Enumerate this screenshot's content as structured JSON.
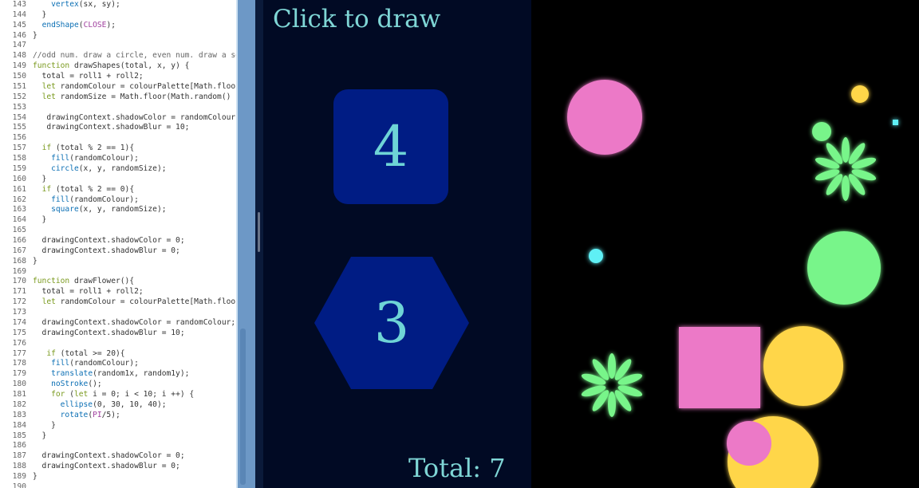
{
  "code_editor": {
    "lines": [
      {
        "n": "143",
        "text": "    vertex(sx, sy);"
      },
      {
        "n": "144",
        "text": "  }"
      },
      {
        "n": "145",
        "text": "  endShape(CLOSE);"
      },
      {
        "n": "146",
        "text": "}"
      },
      {
        "n": "147",
        "text": ""
      },
      {
        "n": "148",
        "text": "//odd num. draw a circle, even num. draw a squ"
      },
      {
        "n": "149",
        "text": "function drawShapes(total, x, y) {"
      },
      {
        "n": "150",
        "text": "  total = roll1 + roll2;"
      },
      {
        "n": "151",
        "text": "  let randomColour = colourPalette[Math.floor("
      },
      {
        "n": "152",
        "text": "  let randomSize = Math.floor(Math.random() *"
      },
      {
        "n": "153",
        "text": ""
      },
      {
        "n": "154",
        "text": "   drawingContext.shadowColor = randomColour;"
      },
      {
        "n": "155",
        "text": "   drawingContext.shadowBlur = 10;"
      },
      {
        "n": "156",
        "text": ""
      },
      {
        "n": "157",
        "text": "  if (total % 2 == 1){"
      },
      {
        "n": "158",
        "text": "    fill(randomColour);"
      },
      {
        "n": "159",
        "text": "    circle(x, y, randomSize);"
      },
      {
        "n": "160",
        "text": "  }"
      },
      {
        "n": "161",
        "text": "  if (total % 2 == 0){"
      },
      {
        "n": "162",
        "text": "    fill(randomColour);"
      },
      {
        "n": "163",
        "text": "    square(x, y, randomSize);"
      },
      {
        "n": "164",
        "text": "  }"
      },
      {
        "n": "165",
        "text": ""
      },
      {
        "n": "166",
        "text": "  drawingContext.shadowColor = 0;"
      },
      {
        "n": "167",
        "text": "  drawingContext.shadowBlur = 0;"
      },
      {
        "n": "168",
        "text": "}"
      },
      {
        "n": "169",
        "text": ""
      },
      {
        "n": "170",
        "text": "function drawFlower(){"
      },
      {
        "n": "171",
        "text": "  total = roll1 + roll2;"
      },
      {
        "n": "172",
        "text": "  let randomColour = colourPalette[Math.floor("
      },
      {
        "n": "173",
        "text": ""
      },
      {
        "n": "174",
        "text": "  drawingContext.shadowColor = randomColour;"
      },
      {
        "n": "175",
        "text": "  drawingContext.shadowBlur = 10;"
      },
      {
        "n": "176",
        "text": ""
      },
      {
        "n": "177",
        "text": "   if (total >= 20){"
      },
      {
        "n": "178",
        "text": "    fill(randomColour);"
      },
      {
        "n": "179",
        "text": "    translate(random1x, random1y);"
      },
      {
        "n": "180",
        "text": "    noStroke();"
      },
      {
        "n": "181",
        "text": "    for (let i = 0; i < 10; i ++) {"
      },
      {
        "n": "182",
        "text": "      ellipse(0, 30, 10, 40);"
      },
      {
        "n": "183",
        "text": "      rotate(PI/5);"
      },
      {
        "n": "184",
        "text": "    }"
      },
      {
        "n": "185",
        "text": "  }"
      },
      {
        "n": "186",
        "text": ""
      },
      {
        "n": "187",
        "text": "  drawingContext.shadowColor = 0;"
      },
      {
        "n": "188",
        "text": "  drawingContext.shadowBlur = 0;"
      },
      {
        "n": "189",
        "text": "}"
      },
      {
        "n": "190",
        "text": ""
      }
    ]
  },
  "app": {
    "click_prompt": "Click to draw",
    "die1_value": "4",
    "die2_value": "3",
    "total_label": "Total: 7"
  },
  "palette": {
    "pink": "#ec79c7",
    "yellow": "#ffd64a",
    "green": "#78f58a",
    "cyan": "#5ff0f5",
    "die_blue": "#001c84",
    "panel_bg": "#010a24",
    "text_teal": "#7fd6d6"
  },
  "canvas_shapes": [
    {
      "kind": "circle",
      "color": "pink"
    },
    {
      "kind": "circle",
      "color": "yellow"
    },
    {
      "kind": "circle",
      "color": "green"
    },
    {
      "kind": "square",
      "color": "cyan"
    },
    {
      "kind": "flower",
      "color": "green"
    },
    {
      "kind": "circle",
      "color": "cyan"
    },
    {
      "kind": "circle",
      "color": "green"
    },
    {
      "kind": "square",
      "color": "pink"
    },
    {
      "kind": "circle",
      "color": "yellow"
    },
    {
      "kind": "flower",
      "color": "green"
    },
    {
      "kind": "circle",
      "color": "yellow"
    },
    {
      "kind": "circle",
      "color": "pink"
    }
  ]
}
